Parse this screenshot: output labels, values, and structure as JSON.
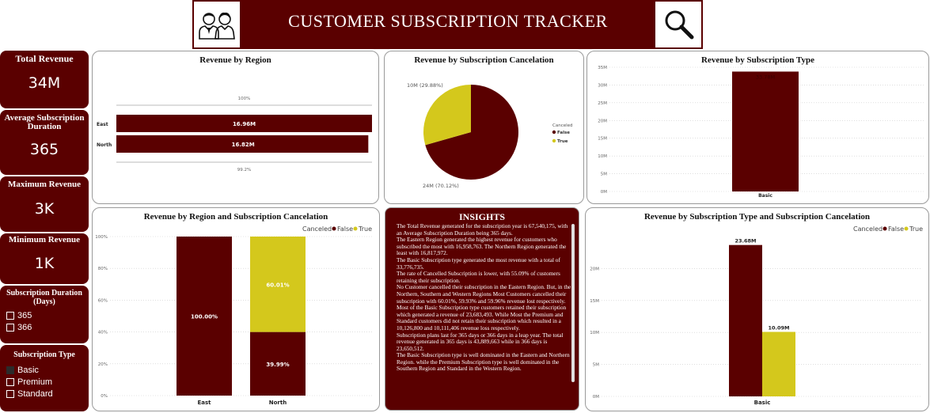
{
  "header": {
    "title": "CUSTOMER SUBSCRIPTION TRACKER",
    "left_icon": "users-icon",
    "right_icon": "search-icon"
  },
  "colors": {
    "brand": "#5a0000",
    "false": "#5a0000",
    "true": "#d4c81c"
  },
  "kpis": {
    "total_revenue": {
      "label": "Total Revenue",
      "value": "34M"
    },
    "avg_duration": {
      "label": "Average Subscription Duration",
      "value": "365"
    },
    "max_revenue": {
      "label": "Maximum Revenue",
      "value": "3K"
    },
    "min_revenue": {
      "label": "Minimum Revenue",
      "value": "1K"
    }
  },
  "slicers": {
    "duration": {
      "title": "Subscription Duration (Days)",
      "options": [
        "365",
        "366"
      ]
    },
    "type": {
      "title": "Subscription Type",
      "options": [
        "Basic",
        "Premium",
        "Standard"
      ],
      "selected": "Basic"
    }
  },
  "insights": {
    "title": "INSIGHTS",
    "paragraphs": [
      "The Total Revenue generated for the subscription year is 67,540,175, with an Average Subscription Duration being 365 days.",
      "The Eastern Region generated the highest revenue for customers who subscribed the most with 16,958,763. The Northern Region generated the least with 16,817,972.",
      "The Basic Subscription type generated the most revenue with a total of 33,776,735.",
      "The rate of Cancelled Subscription is lower, with 55.09% of customers retaining their subscription.",
      "No Customer cancelled their subscription in the Eastern Region. But, in the Northern, Southern and Western Regions Most Customers cancelled their subscription with 60.01%, 59.93% and 59.96% revenue lost respectively.",
      "Most of the Basic Subscription type customers retained their subscription which generated a revenue of  23,683,493. While Most the Premium and Standard customers did not retain their subscription which resulted in a 10,126,800 and 10,111,406 revenue loss respectively.",
      "Subscription plans last for 365 days or 366 days in a leap year. The total revenue generated in 365 days is 43,889,663 while in 366 days is 23,650,512.",
      "The Basic Subscription type is well dominated in the Eastern and Northern Region. while the Premium Subscription type is well dominated in the Southern Region and Standard in the Western Region."
    ]
  },
  "chart_data": [
    {
      "id": "region",
      "type": "bar",
      "orientation": "horizontal",
      "title": "Revenue by Region",
      "categories": [
        "East",
        "North"
      ],
      "values": [
        16.96,
        16.82
      ],
      "value_labels": [
        "16.96M",
        "16.82M"
      ],
      "top_label": "100%",
      "bottom_label": "99.2%"
    },
    {
      "id": "cancelation_pie",
      "type": "pie",
      "title": "Revenue by Subscription Cancelation",
      "legend_title": "Canceled",
      "slices": [
        {
          "name": "False",
          "value": 24,
          "label": "24M (70.12%)",
          "color": "#5a0000"
        },
        {
          "name": "True",
          "value": 10,
          "label": "10M (29.88%)",
          "color": "#d4c81c"
        }
      ],
      "legend_position": "right"
    },
    {
      "id": "sub_type",
      "type": "bar",
      "title": "Revenue by Subscription Type",
      "categories": [
        "Basic"
      ],
      "values": [
        33.78
      ],
      "value_labels": [
        "33.78M"
      ],
      "yticks": [
        "0M",
        "5M",
        "10M",
        "15M",
        "20M",
        "25M",
        "30M",
        "35M"
      ],
      "ylim": [
        0,
        35
      ],
      "grid": true
    },
    {
      "id": "region_cancel",
      "type": "bar",
      "stacked": "100%",
      "title": "Revenue by Region and Subscription Cancelation",
      "legend_title": "Canceled",
      "legend_position": "top-right",
      "categories": [
        "East",
        "North"
      ],
      "series": [
        {
          "name": "False",
          "values": [
            100.0,
            39.99
          ],
          "labels": [
            "100.00%",
            "39.99%"
          ],
          "color": "#5a0000"
        },
        {
          "name": "True",
          "values": [
            0,
            60.01
          ],
          "labels": [
            "",
            "60.01%"
          ],
          "color": "#d4c81c"
        }
      ],
      "yticks": [
        "0%",
        "20%",
        "40%",
        "60%",
        "80%",
        "100%"
      ],
      "ylim": [
        0,
        100
      ],
      "grid": true
    },
    {
      "id": "type_cancel",
      "type": "bar",
      "title": "Revenue by Subscription Type and Subscription Cancelation",
      "legend_title": "Canceled",
      "legend_position": "top-right",
      "categories": [
        "Basic"
      ],
      "series": [
        {
          "name": "False",
          "values": [
            23.68
          ],
          "labels": [
            "23.68M"
          ],
          "color": "#5a0000"
        },
        {
          "name": "True",
          "values": [
            10.09
          ],
          "labels": [
            "10.09M"
          ],
          "color": "#d4c81c"
        }
      ],
      "yticks": [
        "0M",
        "5M",
        "10M",
        "15M",
        "20M"
      ],
      "ylim": [
        0,
        25
      ],
      "grid": true
    }
  ]
}
